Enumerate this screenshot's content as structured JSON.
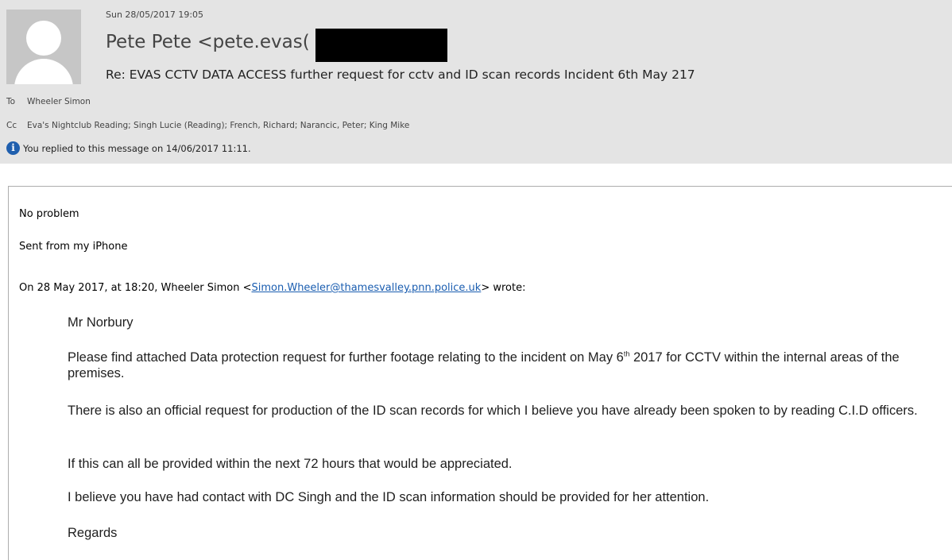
{
  "header": {
    "date": "Sun 28/05/2017 19:05",
    "sender": "Pete Pete <pete.evas(",
    "subject": "Re: EVAS CCTV DATA ACCESS further request for cctv and ID scan records Incident 6th May 217",
    "to_label": "To",
    "to_value": "Wheeler Simon",
    "cc_label": "Cc",
    "cc_value": "Eva's Nightclub Reading; Singh Lucie (Reading); French, Richard; Narancic, Peter; King Mike",
    "info_icon": "info-icon",
    "info_text": "You replied to this message on 14/06/2017 11:11."
  },
  "message": {
    "line1": "No problem",
    "line2": "Sent from my iPhone",
    "wrote_prefix": "On 28 May 2017, at 18:20, Wheeler Simon <",
    "wrote_email": "Simon.Wheeler@thamesvalley.pnn.police.uk",
    "wrote_suffix": "> wrote:"
  },
  "quoted": {
    "greeting": "Mr Norbury",
    "para1_before": "Please find attached Data protection request for further footage relating to the incident on May 6",
    "para1_sup": "th",
    "para1_after": " 2017 for CCTV within the internal areas of the premises.",
    "para2": "There is also an official request for production of the ID scan records for which I believe you have already been spoken to by reading C.I.D officers.",
    "para3": "If this can all be provided within the next 72 hours that would be appreciated.",
    "para4": "I believe you have had contact with DC Singh and the ID scan information should be provided for her attention.",
    "closing": "Regards"
  },
  "colors": {
    "header_bg": "#e4e4e4",
    "link": "#1a5db0",
    "info_icon": "#1f5fae"
  }
}
